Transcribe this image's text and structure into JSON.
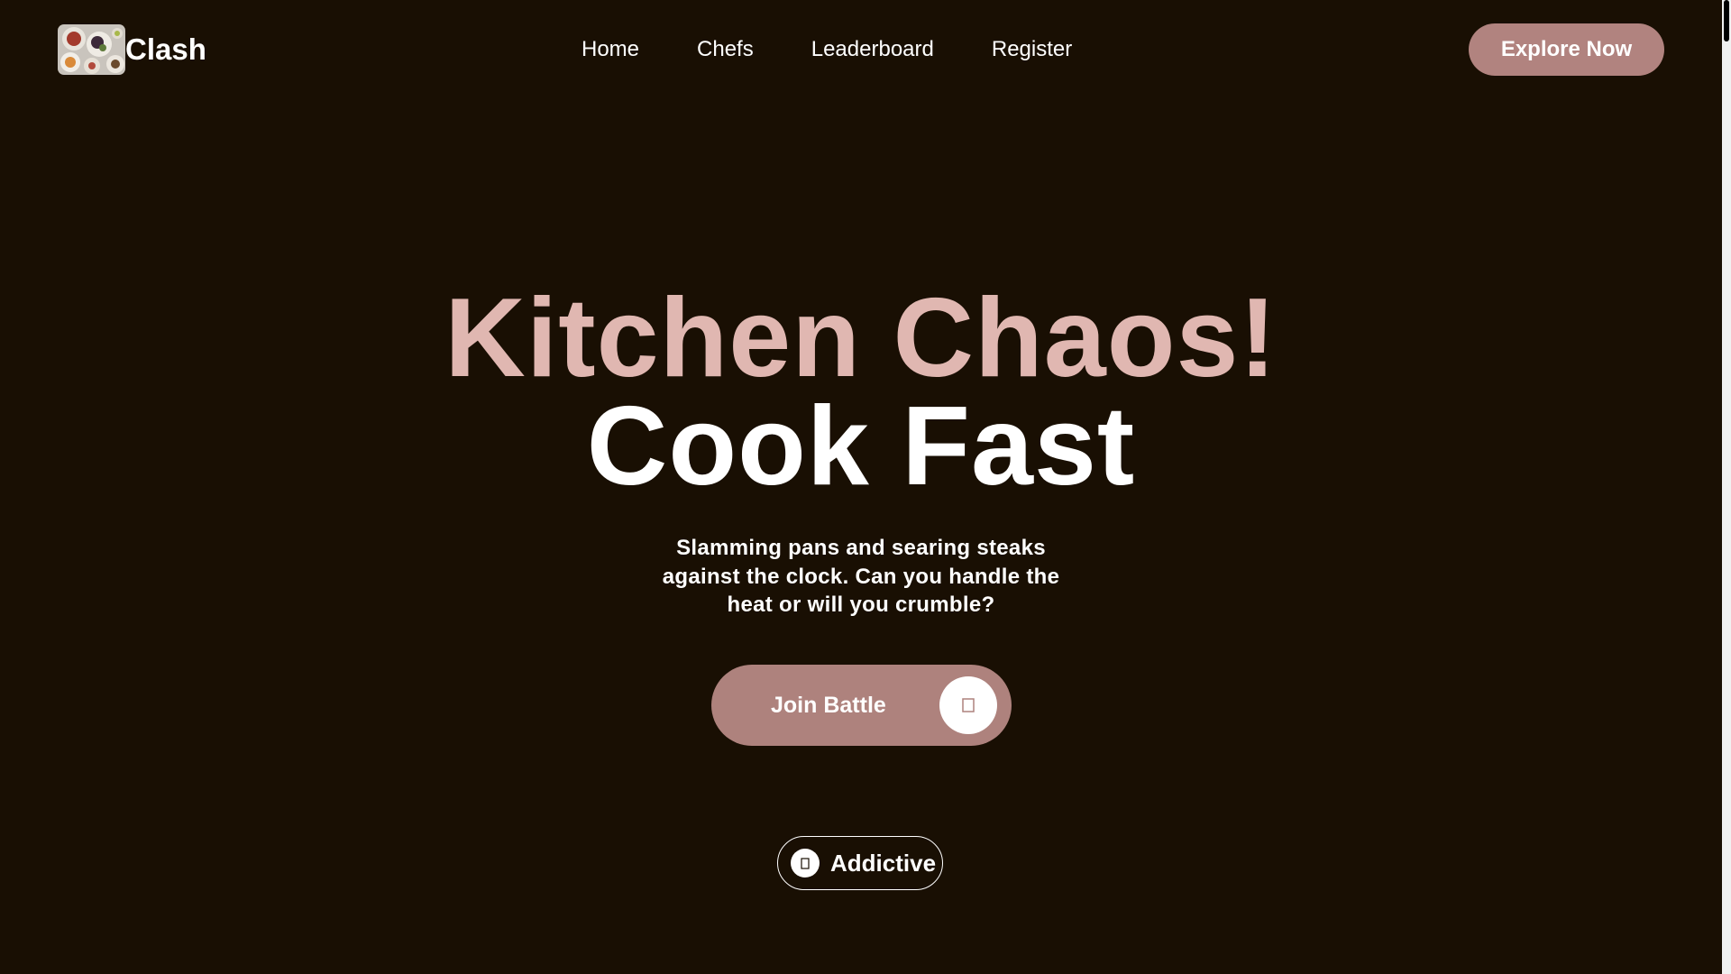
{
  "header": {
    "brand_name": "Clash",
    "logo_icon": "food-platter-logo",
    "nav": [
      {
        "label": "Home"
      },
      {
        "label": "Chefs"
      },
      {
        "label": "Leaderboard"
      },
      {
        "label": "Register"
      }
    ],
    "cta_label": "Explore Now"
  },
  "hero": {
    "title_line_1": "Kitchen Chaos!",
    "title_line_2": "Cook Fast",
    "subtitle": "Slamming pans and searing steaks against the clock. Can you handle the heat or will you crumble?",
    "join_label": "Join Battle",
    "join_icon": "arrow-right-icon",
    "badge_label": "Addictive",
    "badge_icon": "fire-icon"
  },
  "colors": {
    "background": "#190f03",
    "accent": "#b1837f",
    "title_pink": "#e0b7b1",
    "text": "#ffffff"
  }
}
